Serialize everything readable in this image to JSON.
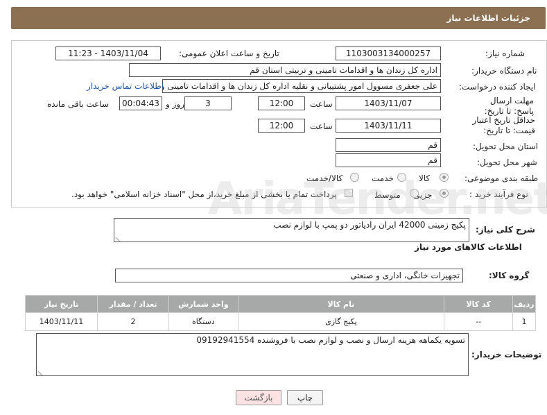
{
  "header": {
    "title": "جزئیات اطلاعات نیاز"
  },
  "form": {
    "need_number_label": "شماره نیاز:",
    "need_number": "1103003134000257",
    "announce_label": "تاریخ و ساعت اعلان عمومی:",
    "announce_value": "1403/11/04 - 11:23",
    "buyer_org_label": "نام دستگاه خریدار:",
    "buyer_org": "اداره کل زندان ها و اقدامات تامینی و تربیتی استان قم",
    "creator_label": "ایجاد کننده درخواست:",
    "creator": "علی جعفری مسوول امور پشتیبانی و نقلیه اداره کل زندان ها و اقدامات تامینی و",
    "contact_link": "اطلاعات تماس خریدار",
    "deadline_label": "مهلت ارسال پاسخ: تا تاریخ:",
    "deadline_date": "1403/11/07",
    "time_label": "ساعت",
    "deadline_time": "12:00",
    "days_value": "3",
    "days_label": "روز و",
    "remaining_value": "00:04:43",
    "remaining_label": "ساعت باقی مانده",
    "validity_label": "حداقل تاریخ اعتبار قیمت: تا تاریخ:",
    "validity_date": "1403/11/11",
    "validity_time": "12:00",
    "province_label": "استان محل تحویل:",
    "province": "قم",
    "city_label": "شهر محل تحویل:",
    "city": "قم",
    "category_label": "طبقه بندی موضوعی:",
    "cat_goods": "کالا",
    "cat_service": "خدمت",
    "cat_both": "کالا/خدمت",
    "process_label": "نوع فرآیند خرید :",
    "proc_partial": "جزیی",
    "proc_medium": "متوسط",
    "payment_note": "پرداخت تمام یا بخشی از مبلغ خرید،از محل \"اسناد خزانه اسلامی\" خواهد بود."
  },
  "summary": {
    "label": "شرح کلی نیاز:",
    "text": "پکیج زمینی 42000 ایران رادیاتور دو پمپ با لوازم نصب"
  },
  "goods_info_title": "اطلاعات کالاهای مورد نیاز",
  "goods_group": {
    "label": "گروه کالا:",
    "value": "تجهیزات خانگی، اداری و صنعتی"
  },
  "table": {
    "headers": [
      "ردیف",
      "کد کالا",
      "نام کالا",
      "واحد شمارش",
      "تعداد / مقدار",
      "تاریخ نیاز"
    ],
    "rows": [
      [
        "1",
        "--",
        "پکیج گازی",
        "دستگاه",
        "2",
        "1403/11/11"
      ]
    ]
  },
  "buyer_notes": {
    "label": "توضیحات خریدار:",
    "text": "تسویه یکماهه هزینه ارسال و نصب و لوازم نصب با فروشنده 09192941554"
  },
  "buttons": {
    "back": "بازگشت",
    "print": "چاپ"
  },
  "watermark": "AriaTender.net"
}
